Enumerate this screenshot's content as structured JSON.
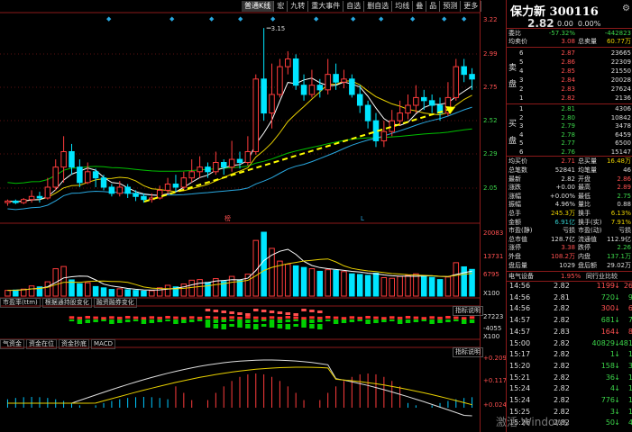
{
  "toolbar": {
    "items": [
      "普通K线",
      "宏",
      "九转",
      "重大事件",
      "自选",
      "删自选",
      "均线",
      "叠",
      "品",
      "预测",
      "更多"
    ]
  },
  "price_axis": {
    "labels": [
      "3.22",
      "2.99",
      "2.75",
      "2.52",
      "2.29",
      "2.05"
    ],
    "peak_label": "3.15"
  },
  "volume_axis": {
    "labels": [
      "20083",
      "13731",
      "6795",
      "X100"
    ]
  },
  "indicator1_axis": {
    "labels": [
      "27223",
      "-4055",
      "X100"
    ]
  },
  "indicator2_axis": {
    "labels": [
      "+0.209",
      "+0.117",
      "+0.024"
    ]
  },
  "sub_tabs_1": [
    "市盈率(ttm)",
    "根据通持股变化",
    "融资融券变化"
  ],
  "sub_tabs_2": [
    "气资金",
    "资金在位",
    "资金抄底",
    "MACD"
  ],
  "indicator_button": "指标说明",
  "markers": {
    "top": "◆",
    "bottom_left": "榜",
    "bottom_right": "L"
  },
  "stock": {
    "name": "保力新",
    "code": "300116",
    "price": "2.82",
    "change": "0.00",
    "change_pct": "0.00%"
  },
  "order_book": {
    "weibi": {
      "label": "委比",
      "value": "-57.32%",
      "diff": "-442823"
    },
    "avg_sell": {
      "label": "均卖价",
      "value": "3.08",
      "label2": "总卖量",
      "value2": "60.77万"
    },
    "sell": [
      {
        "level": "6",
        "price": "2.87",
        "vol": "23665"
      },
      {
        "level": "5",
        "price": "2.86",
        "vol": "22309"
      },
      {
        "level": "4",
        "price": "2.85",
        "vol": "21550"
      },
      {
        "level": "3",
        "price": "2.84",
        "vol": "20028"
      },
      {
        "level": "2",
        "price": "2.83",
        "vol": "27624"
      },
      {
        "level": "1",
        "price": "2.82",
        "vol": "2136"
      }
    ],
    "sell_label": [
      "卖",
      "盘"
    ],
    "buy": [
      {
        "level": "1",
        "price": "2.81",
        "vol": "4306"
      },
      {
        "level": "2",
        "price": "2.80",
        "vol": "10842"
      },
      {
        "level": "3",
        "price": "2.79",
        "vol": "3478"
      },
      {
        "level": "4",
        "price": "2.78",
        "vol": "6459"
      },
      {
        "level": "5",
        "price": "2.77",
        "vol": "6500"
      },
      {
        "level": "6",
        "price": "2.76",
        "vol": "15147"
      }
    ],
    "buy_label": [
      "买",
      "盘"
    ],
    "avg_buy": {
      "label": "均买价",
      "value": "2.71",
      "label2": "总买量",
      "value2": "16.48万"
    }
  },
  "stats": [
    {
      "l1": "总笔数",
      "v1": "52841",
      "c1": "white",
      "l2": "均笔量",
      "v2": "46",
      "c2": "white"
    },
    {
      "l1": "最新",
      "v1": "2.82",
      "c1": "white",
      "l2": "开盘",
      "v2": "2.86",
      "c2": "red"
    },
    {
      "l1": "涨跌",
      "v1": "+0.00",
      "c1": "white",
      "l2": "最高",
      "v2": "2.89",
      "c2": "red"
    },
    {
      "l1": "涨幅",
      "v1": "+0.00%",
      "c1": "white",
      "l2": "最低",
      "v2": "2.75",
      "c2": "green"
    },
    {
      "l1": "振幅",
      "v1": "4.96%",
      "c1": "white",
      "l2": "量比",
      "v2": "0.88",
      "c2": "white"
    },
    {
      "l1": "总手",
      "v1": "245.3万",
      "c1": "yellow",
      "l2": "换手",
      "v2": "6.13%",
      "c2": "yellow"
    },
    {
      "l1": "金额",
      "v1": "6.91亿",
      "c1": "cyan",
      "l2": "换手(实)",
      "v2": "7.91%",
      "c2": "yellow"
    },
    {
      "l1": "市盈(静)",
      "v1": "亏损",
      "c1": "white",
      "l2": "市盈(动)",
      "v2": "亏损",
      "c2": "white"
    },
    {
      "l1": "总市值",
      "v1": "128.7亿",
      "c1": "white",
      "l2": "流通值",
      "v2": "112.9亿",
      "c2": "white"
    },
    {
      "l1": "涨停",
      "v1": "3.38",
      "c1": "red",
      "l2": "跌停",
      "v2": "2.26",
      "c2": "green"
    },
    {
      "l1": "外盘",
      "v1": "108.2万",
      "c1": "red",
      "l2": "内盘",
      "v2": "137.1万",
      "c2": "green"
    },
    {
      "l1": "盘后量",
      "v1": "1029",
      "c1": "white",
      "l2": "盘后额",
      "v2": "29.02万",
      "c2": "white"
    }
  ],
  "sector": {
    "name": "电气设备",
    "pct": "1.95%",
    "compare": "同行业比较"
  },
  "ticks": [
    {
      "time": "14:56",
      "price": "2.82",
      "vol": "1199",
      "dir": "down",
      "dc": "red",
      "n": "26"
    },
    {
      "time": "14:56",
      "price": "2.81",
      "vol": "720",
      "dir": "down",
      "dc": "green",
      "n": "9"
    },
    {
      "time": "14:56",
      "price": "2.82",
      "vol": "300",
      "dir": "down",
      "dc": "red",
      "n": "6"
    },
    {
      "time": "14:57",
      "price": "2.82",
      "vol": "681",
      "dir": "down",
      "dc": "green",
      "n": "7"
    },
    {
      "time": "14:57",
      "price": "2.83",
      "vol": "164",
      "dir": "down",
      "dc": "red",
      "n": "8"
    },
    {
      "time": "15:00",
      "price": "2.82",
      "vol": "40829",
      "dir": "down",
      "dc": "green",
      "n": "481"
    },
    {
      "time": "15:17",
      "price": "2.82",
      "vol": "1",
      "dir": "down",
      "dc": "green",
      "n": "1"
    },
    {
      "time": "15:20",
      "price": "2.82",
      "vol": "158",
      "dir": "down",
      "dc": "green",
      "n": "3"
    },
    {
      "time": "15:21",
      "price": "2.82",
      "vol": "36",
      "dir": "down",
      "dc": "green",
      "n": "1"
    },
    {
      "time": "15:24",
      "price": "2.82",
      "vol": "4",
      "dir": "down",
      "dc": "green",
      "n": "1"
    },
    {
      "time": "15:24",
      "price": "2.82",
      "vol": "776",
      "dir": "down",
      "dc": "green",
      "n": "1"
    },
    {
      "time": "15:25",
      "price": "2.82",
      "vol": "3",
      "dir": "down",
      "dc": "green",
      "n": "1"
    },
    {
      "time": "15:26",
      "price": "2.82",
      "vol": "50",
      "dir": "down",
      "dc": "green",
      "n": "4"
    }
  ],
  "watermark": "激活 Windows",
  "colors": {
    "up": "#ff3c3c",
    "down": "#00e5ff",
    "ma5": "#ffffff",
    "ma10": "#e8d000",
    "ma20": "#ff40ff",
    "ma60": "#00c000",
    "trend": "#ffff00"
  },
  "chart_data": {
    "type": "candlestick",
    "ylim": [
      1.98,
      3.25
    ],
    "candles": [
      [
        2.02,
        2.03,
        2.0,
        2.04
      ],
      [
        2.03,
        2.02,
        2.01,
        2.04
      ],
      [
        2.02,
        2.04,
        2.01,
        2.05
      ],
      [
        2.04,
        2.06,
        2.02,
        2.1
      ],
      [
        2.06,
        2.05,
        2.02,
        2.09
      ],
      [
        2.05,
        2.12,
        2.04,
        2.18
      ],
      [
        2.12,
        2.25,
        2.1,
        2.3
      ],
      [
        2.25,
        2.35,
        2.15,
        2.45
      ],
      [
        2.35,
        2.25,
        2.2,
        2.4
      ],
      [
        2.25,
        2.15,
        2.12,
        2.3
      ],
      [
        2.15,
        2.22,
        2.14,
        2.28
      ],
      [
        2.22,
        2.18,
        2.12,
        2.24
      ],
      [
        2.18,
        2.12,
        2.1,
        2.2
      ],
      [
        2.12,
        2.08,
        2.06,
        2.14
      ],
      [
        2.08,
        2.12,
        2.06,
        2.16
      ],
      [
        2.12,
        2.08,
        2.05,
        2.14
      ],
      [
        2.08,
        2.06,
        2.03,
        2.1
      ],
      [
        2.06,
        2.04,
        2.02,
        2.08
      ],
      [
        2.04,
        2.05,
        2.02,
        2.08
      ],
      [
        2.05,
        2.1,
        2.04,
        2.13
      ],
      [
        2.1,
        2.14,
        2.08,
        2.18
      ],
      [
        2.14,
        2.12,
        2.09,
        2.2
      ],
      [
        2.12,
        2.18,
        2.1,
        2.22
      ],
      [
        2.18,
        2.22,
        2.15,
        2.3
      ],
      [
        2.22,
        2.25,
        2.18,
        2.32
      ],
      [
        2.25,
        2.22,
        2.18,
        2.28
      ],
      [
        2.22,
        2.28,
        2.2,
        2.35
      ],
      [
        2.28,
        2.25,
        2.2,
        2.3
      ],
      [
        2.25,
        2.3,
        2.22,
        2.42
      ],
      [
        2.3,
        2.28,
        2.24,
        2.35
      ],
      [
        2.28,
        2.35,
        2.26,
        2.45
      ],
      [
        2.35,
        2.82,
        2.33,
        2.85
      ],
      [
        2.82,
        2.6,
        2.55,
        3.15
      ],
      [
        2.6,
        2.72,
        2.5,
        2.92
      ],
      [
        2.72,
        2.9,
        2.7,
        2.95
      ],
      [
        2.9,
        2.95,
        2.85,
        3.0
      ],
      [
        2.95,
        2.78,
        2.75,
        2.98
      ],
      [
        2.78,
        2.72,
        2.68,
        2.85
      ],
      [
        2.72,
        2.78,
        2.7,
        2.88
      ],
      [
        2.78,
        2.75,
        2.7,
        2.82
      ],
      [
        2.75,
        2.85,
        2.72,
        2.95
      ],
      [
        2.85,
        2.8,
        2.75,
        2.92
      ],
      [
        2.8,
        2.82,
        2.76,
        2.88
      ],
      [
        2.82,
        2.72,
        2.7,
        2.85
      ],
      [
        2.72,
        2.65,
        2.6,
        2.78
      ],
      [
        2.65,
        2.55,
        2.5,
        2.68
      ],
      [
        2.55,
        2.42,
        2.38,
        2.6
      ],
      [
        2.42,
        2.48,
        2.38,
        2.55
      ],
      [
        2.48,
        2.55,
        2.45,
        2.62
      ],
      [
        2.55,
        2.6,
        2.52,
        2.68
      ],
      [
        2.6,
        2.65,
        2.56,
        2.72
      ],
      [
        2.65,
        2.7,
        2.6,
        2.78
      ],
      [
        2.7,
        2.68,
        2.62,
        2.75
      ],
      [
        2.68,
        2.65,
        2.6,
        2.72
      ],
      [
        2.65,
        2.6,
        2.55,
        2.7
      ],
      [
        2.6,
        2.7,
        2.58,
        2.8
      ],
      [
        2.7,
        2.9,
        2.68,
        2.95
      ],
      [
        2.9,
        2.85,
        2.8,
        2.95
      ],
      [
        2.85,
        2.82,
        2.75,
        2.89
      ]
    ],
    "volume": [
      1800,
      1900,
      2200,
      3200,
      2900,
      4500,
      8600,
      9300,
      5100,
      3900,
      4200,
      3000,
      2600,
      2100,
      2300,
      2000,
      1800,
      1600,
      1700,
      2600,
      3400,
      2900,
      3800,
      5000,
      5200,
      4300,
      5500,
      4600,
      6200,
      5000,
      6900,
      17500,
      20083,
      15000,
      11000,
      10000,
      9500,
      9000,
      8600,
      7800,
      8300,
      8100,
      7700,
      7000,
      6800,
      6500,
      7200,
      5800,
      5600,
      6200,
      6500,
      7000,
      6400,
      5900,
      5200,
      6000,
      10500,
      9200,
      8400
    ]
  }
}
